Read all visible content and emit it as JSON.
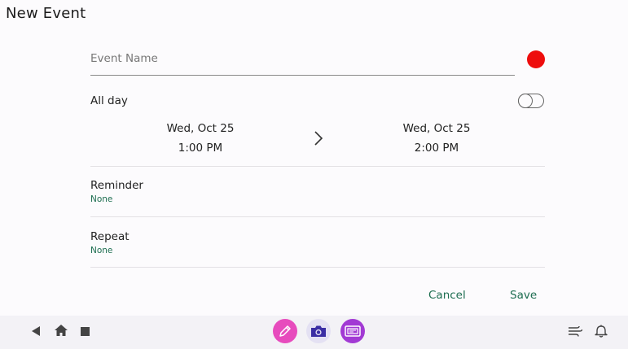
{
  "header": {
    "title": "New Event"
  },
  "event_name": {
    "placeholder": "Event Name",
    "value": ""
  },
  "color": {
    "selected": "#ee0d0d"
  },
  "all_day": {
    "label": "All day",
    "enabled": false
  },
  "start": {
    "date": "Wed, Oct 25",
    "time": "1:00 PM"
  },
  "end": {
    "date": "Wed, Oct 25",
    "time": "2:00 PM"
  },
  "reminder": {
    "title": "Reminder",
    "value": "None"
  },
  "repeat": {
    "title": "Repeat",
    "value": "None"
  },
  "actions": {
    "cancel_label": "Cancel",
    "save_label": "Save"
  },
  "navbar": {
    "left_icons": [
      "back-icon",
      "home-icon",
      "recents-icon"
    ],
    "apps": [
      {
        "name": "pencil-app-icon",
        "color": "#e74bbd"
      },
      {
        "name": "camera-app-icon",
        "color": "#e4e1f3"
      },
      {
        "name": "screenshot-app-icon",
        "color": "#a23ad4"
      }
    ],
    "right_icons": [
      "wind-icon",
      "bell-icon"
    ]
  },
  "colors": {
    "accent": "#1e6e51",
    "background": "#fcfbfd",
    "navbar": "#f3f2f6"
  }
}
